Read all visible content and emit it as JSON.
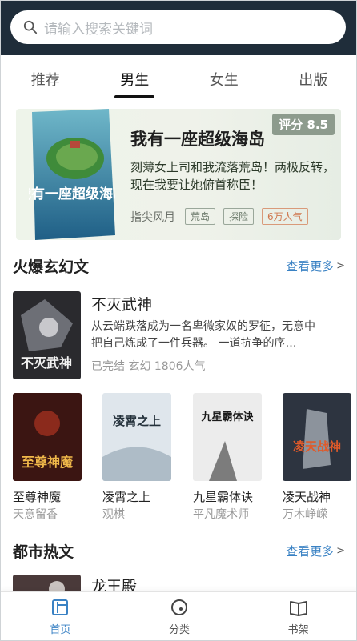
{
  "search": {
    "placeholder": "请输入搜索关键词",
    "icon": "search-icon"
  },
  "tabs": [
    {
      "label": "推荐",
      "active": false
    },
    {
      "label": "男生",
      "active": true
    },
    {
      "label": "女生",
      "active": false
    },
    {
      "label": "出版",
      "active": false
    }
  ],
  "banner": {
    "title": "我有一座超级海岛",
    "rating": "评分 8.5",
    "description": "刻薄女上司和我流落荒岛！两极反转，现在我要让她俯首称臣！",
    "author": "指尖风月",
    "tags": [
      "荒岛",
      "探险"
    ],
    "popularity": "6万人气",
    "cover_text": "我有一座超级海岛"
  },
  "section1": {
    "title": "火爆玄幻文",
    "more": "查看更多",
    "featured": {
      "title": "不灭武神",
      "description": "从云端跌落成为一名卑微家奴的罗征，无意中把自己炼成了一件兵器。 一道抗争的序…",
      "meta": "已完结 玄幻 1806人气",
      "cover_text": "不灭武神"
    },
    "grid": [
      {
        "title": "至尊神魔",
        "author": "天意留香",
        "cover_text": "至尊神魔"
      },
      {
        "title": "凌霄之上",
        "author": "观棋",
        "cover_text": "凌霄之上"
      },
      {
        "title": "九星霸体诀",
        "author": "平凡魔术师",
        "cover_text": "九星霸体诀"
      },
      {
        "title": "凌天战神",
        "author": "万木峥嵘",
        "cover_text": "凌天战神"
      }
    ]
  },
  "section2": {
    "title": "都市热文",
    "more": "查看更多",
    "featured": {
      "title": "龙王殿"
    }
  },
  "bottom_nav": [
    {
      "label": "首页",
      "icon": "home-icon",
      "active": true
    },
    {
      "label": "分类",
      "icon": "category-icon",
      "active": false
    },
    {
      "label": "书架",
      "icon": "bookshelf-icon",
      "active": false
    }
  ],
  "colors": {
    "header_bg": "#1f2d3a",
    "accent": "#3a82c4",
    "rating_bg": "#8d9b8d"
  }
}
